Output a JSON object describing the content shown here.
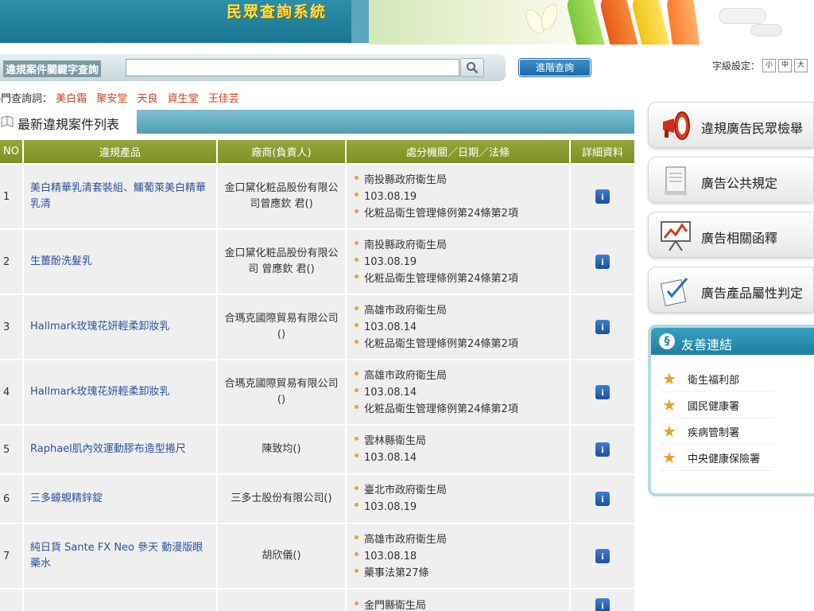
{
  "header": {
    "site_title": "民眾查詢系統"
  },
  "search": {
    "label": "違規案件關鍵字查詢",
    "value": "",
    "placeholder": "",
    "advanced_label": "進階查詢"
  },
  "font_size": {
    "label": "字級設定：",
    "small": "小",
    "medium": "中",
    "large": "大"
  },
  "hot_keywords": {
    "label": "熱門查詢詞：",
    "items": [
      "美白霜",
      "聚安堂",
      "天良",
      "資生堂",
      "王佳芸"
    ]
  },
  "list": {
    "title": "最新違規案件列表",
    "columns": {
      "no": "NO",
      "product": "違規產品",
      "firm": "廠商(負責人)",
      "authority": "處分機關／日期／法條",
      "detail": "詳細資料"
    },
    "rows": [
      {
        "no": "1",
        "product": "美白精華乳清套裝組、鱷葡萊美白精華乳清",
        "firm": "金口黛化粧品股份有限公司曾應欽 君()",
        "authority": [
          "南投縣政府衛生局",
          "103.08.19",
          "化粧品衛生管理條例第24條第2項"
        ]
      },
      {
        "no": "2",
        "product": "生薑酚洗髮乳",
        "firm": "金口黛化粧品股份有限公司 曾應欽 君()",
        "authority": [
          "南投縣政府衛生局",
          "103.08.19",
          "化粧品衛生管理條例第24條第2項"
        ]
      },
      {
        "no": "3",
        "product": "Hallmark玫瑰花妍輕柔卸妝乳",
        "firm": "合瑪克國際貿易有限公司()",
        "authority": [
          "高雄市政府衛生局",
          "103.08.14",
          "化粧品衛生管理條例第24條第2項"
        ]
      },
      {
        "no": "4",
        "product": "Hallmark玫瑰花妍輕柔卸妝乳",
        "firm": "合瑪克國際貿易有限公司()",
        "authority": [
          "高雄市政府衛生局",
          "103.08.14",
          "化粧品衛生管理條例第24條第2項"
        ]
      },
      {
        "no": "5",
        "product": "Raphael肌內效運動膠布造型捲尺",
        "firm": "陳致均()",
        "authority": [
          "雲林縣衛生局",
          "103.08.14"
        ]
      },
      {
        "no": "6",
        "product": "三多蠔蜆精鋅錠",
        "firm": "三多士股份有限公司()",
        "authority": [
          "臺北市政府衛生局",
          "103.08.19"
        ]
      },
      {
        "no": "7",
        "product": "純日貨 Sante FX Neo 參天 動漫版眼藥水",
        "firm": "胡欣儀()",
        "authority": [
          "高雄市政府衛生局",
          "103.08.18",
          "藥事法第27條"
        ]
      },
      {
        "no": "",
        "product": "",
        "firm": "",
        "authority": [
          "金門縣衛生局"
        ]
      }
    ]
  },
  "side": {
    "report": "違規廣告民眾檢舉",
    "rules": "廣告公共規定",
    "interpret": "廣告相關函釋",
    "attribute": "廣告產品屬性判定"
  },
  "links": {
    "title": "友善連結",
    "items": [
      "衛生福利部",
      "國民健康署",
      "疾病管制署",
      "中央健康保險署"
    ]
  },
  "colors": {
    "table_header": "#87992c",
    "accent_blue": "#1d7fa1",
    "keyword": "#c8421b",
    "product_link": "#2a52a0"
  }
}
